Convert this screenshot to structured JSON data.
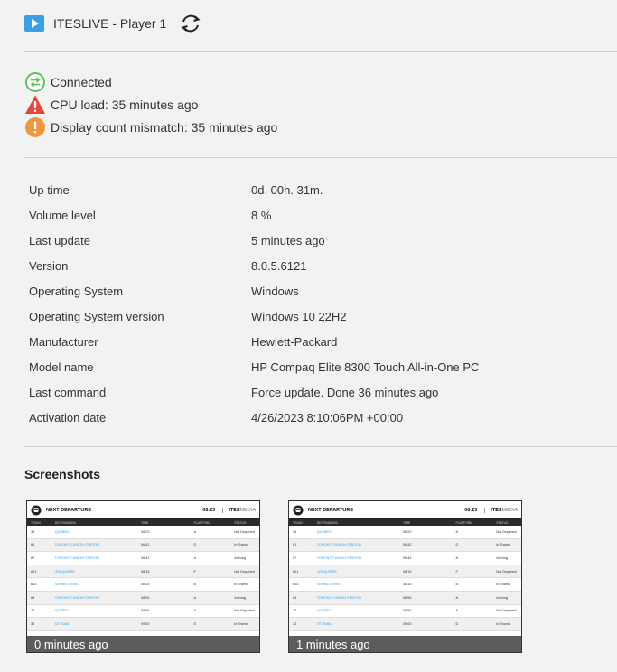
{
  "header": {
    "title": "ITESLIVE - Player 1",
    "icon": "play-icon",
    "refresh_icon": "refresh-icon"
  },
  "statuses": [
    {
      "text": "Connected",
      "icon": "connected-icon",
      "color": "#5cc35a"
    },
    {
      "text": "CPU load: 35 minutes ago",
      "icon": "warning-icon",
      "color": "#e8443a"
    },
    {
      "text": "Display count mismatch: 35 minutes ago",
      "icon": "alert-icon",
      "color": "#f0963c"
    }
  ],
  "info": [
    {
      "label": "Up time",
      "value": "0d. 00h. 31m."
    },
    {
      "label": "Volume level",
      "value": "8 %"
    },
    {
      "label": "Last update",
      "value": "5 minutes ago"
    },
    {
      "label": "Version",
      "value": "8.0.5.6121"
    },
    {
      "label": "Operating System",
      "value": "Windows"
    },
    {
      "label": "Operating System version",
      "value": "Windows 10 22H2"
    },
    {
      "label": "Manufacturer",
      "value": "Hewlett-Packard"
    },
    {
      "label": "Model name",
      "value": "HP Compaq Elite 8300 Touch All-in-One PC"
    },
    {
      "label": "Last command",
      "value": "Force update. Done 36 minutes ago"
    },
    {
      "label": "Activation date",
      "value": "4/26/2023 8:10:06PM +00:00"
    }
  ],
  "screenshots": {
    "title": "Screenshots",
    "items": [
      {
        "caption": "0 minutes ago"
      },
      {
        "caption": "1 minutes ago"
      }
    ],
    "board": {
      "title": "NEXT DEPARTURE",
      "time": "08:23",
      "brand_a": "ITES",
      "brand_b": "MEDIA",
      "columns": [
        "TRAIN",
        "DESTINATION",
        "TIME",
        "PLATFORM",
        "STATUS"
      ],
      "rows": [
        [
          "35",
          "QUÉBEC",
          "06:20",
          "A",
          "Not Departed"
        ],
        [
          "61",
          "TORONTO UNION STATION",
          "06:42",
          "D",
          "In Transit"
        ],
        [
          "67",
          "TORONTO UNION STATION",
          "06:42",
          "A",
          "Arriving"
        ],
        [
          "601",
          "JONQUIÈRE",
          "08:15",
          "F",
          "Not Departed"
        ],
        [
          "603",
          "SENNETERRE",
          "08:15",
          "B",
          "In Transit"
        ],
        [
          "63",
          "TORONTO UNION STATION",
          "08:55",
          "A",
          "Arriving"
        ],
        [
          "22",
          "QUÉBEC",
          "08:56",
          "A",
          "Not Departed"
        ],
        [
          "33",
          "OTTAWA",
          "09:00",
          "D",
          "In Transit"
        ]
      ]
    }
  }
}
